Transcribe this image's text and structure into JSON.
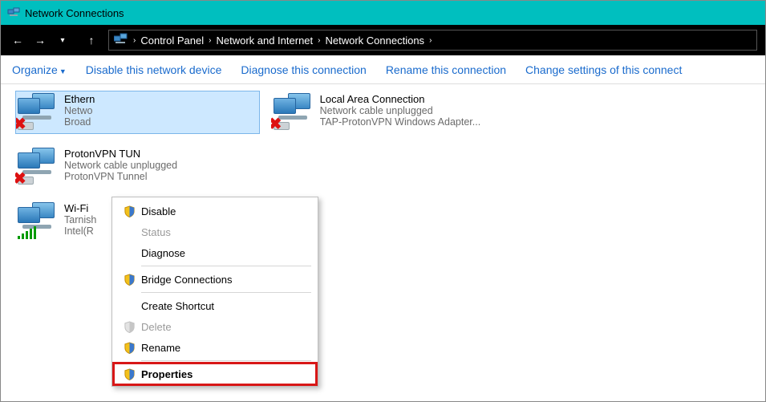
{
  "title": "Network Connections",
  "breadcrumb": [
    "Control Panel",
    "Network and Internet",
    "Network Connections"
  ],
  "commands": {
    "organize": "Organize",
    "disable": "Disable this network device",
    "diagnose": "Diagnose this connection",
    "rename": "Rename this connection",
    "change": "Change settings of this connect"
  },
  "items": [
    {
      "name": "Ethern",
      "status": "Netwo",
      "device": "Broad",
      "selected": true,
      "kind": "wired",
      "redx": true
    },
    {
      "name": "Local Area Connection",
      "status": "Network cable unplugged",
      "device": "TAP-ProtonVPN Windows Adapter...",
      "kind": "wired",
      "redx": true
    },
    {
      "name": "ProtonVPN TUN",
      "status": "Network cable unplugged",
      "device": "ProtonVPN Tunnel",
      "kind": "wired",
      "redx": true
    },
    {
      "name": "Wi-Fi",
      "status": "Tarnish",
      "device": "Intel(R",
      "kind": "wifi",
      "redx": false
    }
  ],
  "menu": {
    "disable": "Disable",
    "status": "Status",
    "diagnose": "Diagnose",
    "bridge": "Bridge Connections",
    "shortcut": "Create Shortcut",
    "delete": "Delete",
    "rename": "Rename",
    "properties": "Properties"
  }
}
